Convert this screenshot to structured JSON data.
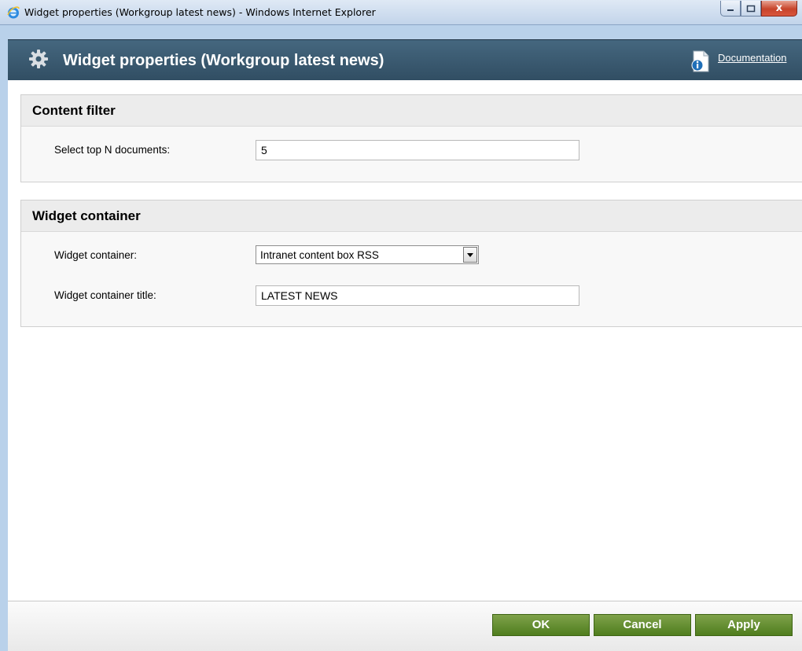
{
  "window": {
    "title": "Widget properties (Workgroup latest news) - Windows Internet Explorer",
    "icon": "internet-explorer-icon"
  },
  "header": {
    "title": "Widget properties (Workgroup latest news)",
    "documentation_link": "Documentation"
  },
  "sections": {
    "content_filter": {
      "title": "Content filter",
      "top_n_label": "Select top N documents:",
      "top_n_value": "5"
    },
    "widget_container": {
      "title": "Widget container",
      "container_label": "Widget container:",
      "container_selected": "Intranet content box RSS",
      "title_label": "Widget container title:",
      "title_value": "LATEST NEWS"
    }
  },
  "footer": {
    "ok_label": "OK",
    "cancel_label": "Cancel",
    "apply_label": "Apply"
  },
  "colors": {
    "header_bg": "#3b5b71",
    "button_green": "#5e8a29",
    "close_red": "#c7442b"
  }
}
